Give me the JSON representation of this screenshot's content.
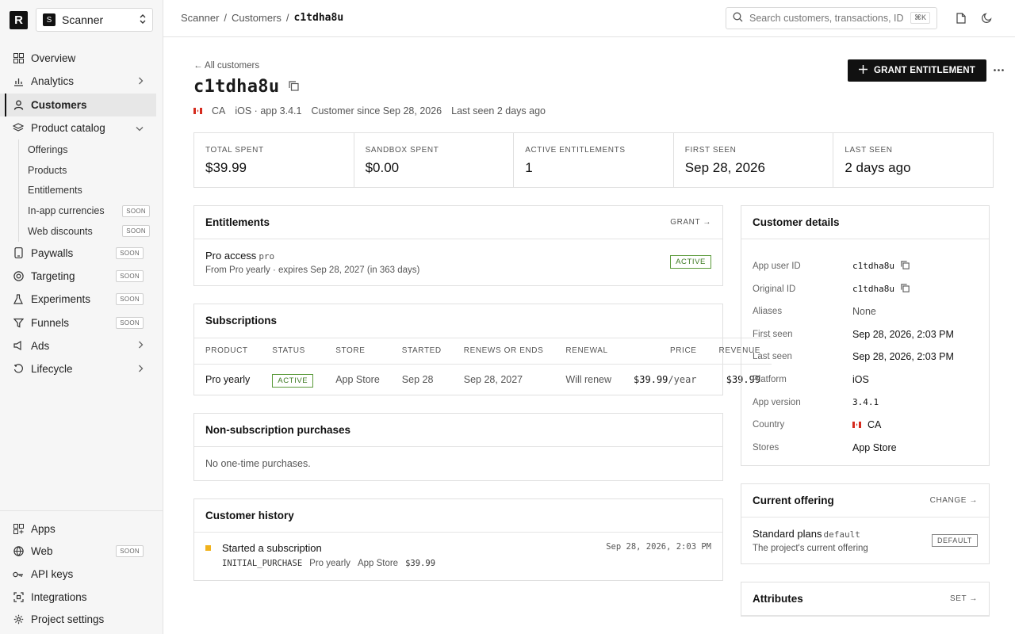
{
  "sidebar": {
    "logo": "R",
    "project": {
      "badge": "S",
      "name": "Scanner"
    },
    "nav": [
      {
        "label": "Overview",
        "icon": "grid-icon"
      },
      {
        "label": "Analytics",
        "icon": "bar-chart-icon"
      },
      {
        "label": "Customers",
        "icon": "user-icon"
      },
      {
        "label": "Product catalog",
        "icon": "layers-icon"
      }
    ],
    "catalog_sub": [
      {
        "label": "Offerings",
        "soon": ""
      },
      {
        "label": "Products",
        "soon": ""
      },
      {
        "label": "Entitlements",
        "soon": ""
      },
      {
        "label": "In-app currencies",
        "soon": "SOON"
      },
      {
        "label": "Web discounts",
        "soon": "SOON"
      }
    ],
    "nav2": [
      {
        "label": "Paywalls",
        "soon": "SOON"
      },
      {
        "label": "Targeting",
        "soon": "SOON"
      },
      {
        "label": "Experiments",
        "soon": "SOON"
      },
      {
        "label": "Funnels",
        "soon": "SOON"
      },
      {
        "label": "Ads"
      },
      {
        "label": "Lifecycle"
      }
    ],
    "bottom": [
      {
        "label": "Apps"
      },
      {
        "label": "Web",
        "soon": "SOON"
      },
      {
        "label": "API keys"
      },
      {
        "label": "Integrations"
      },
      {
        "label": "Project settings"
      }
    ]
  },
  "topbar": {
    "crumbs": [
      "Scanner",
      "/",
      "Customers",
      "/",
      "c1tdha8u"
    ],
    "search_placeholder": "Search customers, transactions, IDs",
    "search_kbd": "⌘K"
  },
  "header": {
    "back": "← All customers",
    "title": "c1tdha8u",
    "country": "CA",
    "platform": "iOS · app 3.4.1",
    "since": "Customer since Sep 28, 2026",
    "last_seen": "Last seen 2 days ago",
    "grant_label": "GRANT ENTITLEMENT"
  },
  "stats": [
    {
      "label": "TOTAL SPENT",
      "value": "$39.99"
    },
    {
      "label": "SANDBOX SPENT",
      "value": "$0.00"
    },
    {
      "label": "ACTIVE ENTITLEMENTS",
      "value": "1"
    },
    {
      "label": "FIRST SEEN",
      "value": "Sep 28, 2026"
    },
    {
      "label": "LAST SEEN",
      "value": "2 days ago"
    }
  ],
  "entitlements": {
    "title": "Entitlements",
    "link": "GRANT →",
    "name": "Pro access",
    "id": "pro",
    "sub": "From Pro yearly · expires Sep 28, 2027 (in 363 days)",
    "status": "ACTIVE"
  },
  "subscriptions": {
    "title": "Subscriptions",
    "columns": [
      "PRODUCT",
      "STATUS",
      "STORE",
      "STARTED",
      "RENEWS OR ENDS",
      "RENEWAL",
      "PRICE",
      "REVENUE"
    ],
    "row": {
      "product": "Pro yearly",
      "status": "ACTIVE",
      "store": "App Store",
      "started": "Sep 28",
      "renews": "Sep 28, 2027",
      "renewal": "Will renew",
      "price": "$39.99",
      "per": "/year",
      "revenue": "$39.99"
    }
  },
  "nonsub": {
    "title": "Non-subscription purchases",
    "empty": "No one-time purchases."
  },
  "history": {
    "title": "Customer history",
    "event": "Started a subscription",
    "type": "INITIAL_PURCHASE",
    "product": "Pro yearly",
    "store": "App Store",
    "amount": "$39.99",
    "time": "Sep 28, 2026, 2:03 PM"
  },
  "details": {
    "title": "Customer details",
    "rows": [
      {
        "key": "App user ID",
        "value": "c1tdha8u"
      },
      {
        "key": "Original ID",
        "value": "c1tdha8u"
      },
      {
        "key": "Aliases",
        "value": "None"
      },
      {
        "key": "First seen",
        "value": "Sep 28, 2026, 2:03 PM"
      },
      {
        "key": "Last seen",
        "value": "Sep 28, 2026, 2:03 PM"
      },
      {
        "key": "Platform",
        "value": "iOS"
      },
      {
        "key": "App version",
        "value": "3.4.1"
      },
      {
        "key": "Country",
        "value": "CA"
      },
      {
        "key": "Stores",
        "value": "App Store"
      }
    ]
  },
  "offering": {
    "title": "Current offering",
    "link": "CHANGE →",
    "name": "Standard plans",
    "id": "default",
    "sub": "The project's current offering",
    "badge": "DEFAULT"
  },
  "attributes": {
    "title": "Attributes",
    "link": "SET →"
  },
  "colors": {
    "active": "#3d7a23",
    "history_dot": "#f1b21c",
    "flag_red": "#d52b1e"
  }
}
